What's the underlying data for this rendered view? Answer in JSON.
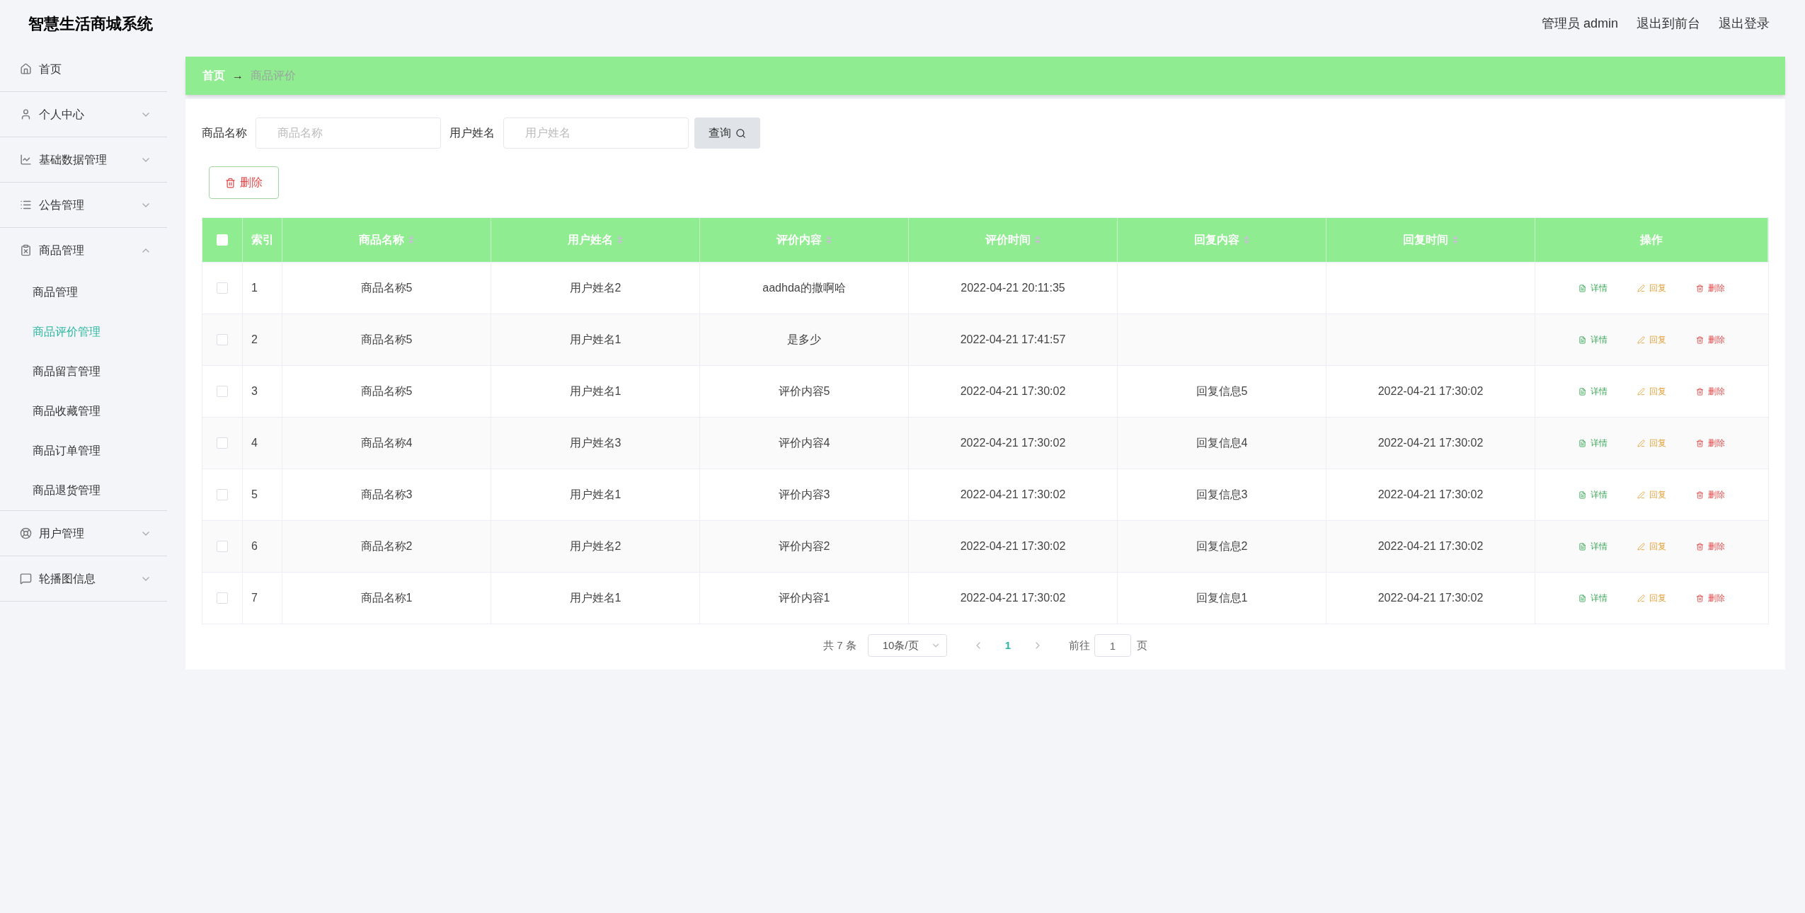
{
  "app_title": "智慧生活商城系统",
  "header_links": [
    {
      "label": "管理员 admin"
    },
    {
      "label": "退出到前台"
    },
    {
      "label": "退出登录"
    }
  ],
  "sidebar": {
    "items": [
      {
        "label": "首页",
        "kind": "link"
      },
      {
        "label": "个人中心",
        "kind": "group",
        "expanded": false
      },
      {
        "label": "基础数据管理",
        "kind": "group",
        "expanded": false
      },
      {
        "label": "公告管理",
        "kind": "group",
        "expanded": false
      },
      {
        "label": "商品管理",
        "kind": "group",
        "expanded": true,
        "children": [
          {
            "label": "商品管理",
            "selected": false
          },
          {
            "label": "商品评价管理",
            "selected": true
          },
          {
            "label": "商品留言管理",
            "selected": false
          },
          {
            "label": "商品收藏管理",
            "selected": false
          },
          {
            "label": "商品订单管理",
            "selected": false
          },
          {
            "label": "商品退货管理",
            "selected": false
          }
        ]
      },
      {
        "label": "用户管理",
        "kind": "group",
        "expanded": false
      },
      {
        "label": "轮播图信息",
        "kind": "group",
        "expanded": false
      }
    ]
  },
  "breadcrumb": {
    "home": "首页",
    "separator": "→",
    "current": "商品评价"
  },
  "search": {
    "fields": [
      {
        "label": "商品名称",
        "placeholder": "商品名称"
      },
      {
        "label": "用户姓名",
        "placeholder": "用户姓名"
      }
    ],
    "button": "查询"
  },
  "delete_button": "删除",
  "table": {
    "select_all_checked": false,
    "columns": [
      {
        "label": "索引",
        "sortable": false
      },
      {
        "label": "商品名称",
        "sortable": true
      },
      {
        "label": "用户姓名",
        "sortable": true
      },
      {
        "label": "评价内容",
        "sortable": true
      },
      {
        "label": "评价时间",
        "sortable": true
      },
      {
        "label": "回复内容",
        "sortable": true
      },
      {
        "label": "回复时间",
        "sortable": true
      },
      {
        "label": "操作",
        "sortable": false
      }
    ],
    "rows": [
      {
        "checked": false,
        "cells": [
          "1",
          "商品名称5",
          "用户姓名2",
          "aadhda的撒啊哈",
          "2022-04-21 20:11:35",
          "",
          ""
        ],
        "actions": [
          {
            "label": "详情",
            "kind": "detail"
          },
          {
            "label": "回复",
            "kind": "reply"
          },
          {
            "label": "删除",
            "kind": "delete"
          }
        ]
      },
      {
        "checked": false,
        "cells": [
          "2",
          "商品名称5",
          "用户姓名1",
          "是多少",
          "2022-04-21 17:41:57",
          "",
          ""
        ],
        "actions": [
          {
            "label": "详情",
            "kind": "detail"
          },
          {
            "label": "回复",
            "kind": "reply"
          },
          {
            "label": "删除",
            "kind": "delete"
          }
        ]
      },
      {
        "checked": false,
        "cells": [
          "3",
          "商品名称5",
          "用户姓名1",
          "评价内容5",
          "2022-04-21 17:30:02",
          "回复信息5",
          "2022-04-21 17:30:02"
        ],
        "actions": [
          {
            "label": "详情",
            "kind": "detail"
          },
          {
            "label": "回复",
            "kind": "reply"
          },
          {
            "label": "删除",
            "kind": "delete"
          }
        ]
      },
      {
        "checked": false,
        "cells": [
          "4",
          "商品名称4",
          "用户姓名3",
          "评价内容4",
          "2022-04-21 17:30:02",
          "回复信息4",
          "2022-04-21 17:30:02"
        ],
        "actions": [
          {
            "label": "详情",
            "kind": "detail"
          },
          {
            "label": "回复",
            "kind": "reply"
          },
          {
            "label": "删除",
            "kind": "delete"
          }
        ]
      },
      {
        "checked": false,
        "cells": [
          "5",
          "商品名称3",
          "用户姓名1",
          "评价内容3",
          "2022-04-21 17:30:02",
          "回复信息3",
          "2022-04-21 17:30:02"
        ],
        "actions": [
          {
            "label": "详情",
            "kind": "detail"
          },
          {
            "label": "回复",
            "kind": "reply"
          },
          {
            "label": "删除",
            "kind": "delete"
          }
        ]
      },
      {
        "checked": false,
        "cells": [
          "6",
          "商品名称2",
          "用户姓名2",
          "评价内容2",
          "2022-04-21 17:30:02",
          "回复信息2",
          "2022-04-21 17:30:02"
        ],
        "actions": [
          {
            "label": "详情",
            "kind": "detail"
          },
          {
            "label": "回复",
            "kind": "reply"
          },
          {
            "label": "删除",
            "kind": "delete"
          }
        ]
      },
      {
        "checked": false,
        "cells": [
          "7",
          "商品名称1",
          "用户姓名1",
          "评价内容1",
          "2022-04-21 17:30:02",
          "回复信息1",
          "2022-04-21 17:30:02"
        ],
        "actions": [
          {
            "label": "详情",
            "kind": "detail"
          },
          {
            "label": "回复",
            "kind": "reply"
          },
          {
            "label": "删除",
            "kind": "delete"
          }
        ]
      }
    ]
  },
  "pagination": {
    "total": "共 7 条",
    "page_size": "10条/页",
    "pages": [
      {
        "label": "1",
        "selected": true
      }
    ],
    "goto_label": "前往",
    "goto_value": "1",
    "goto_suffix": "页"
  }
}
